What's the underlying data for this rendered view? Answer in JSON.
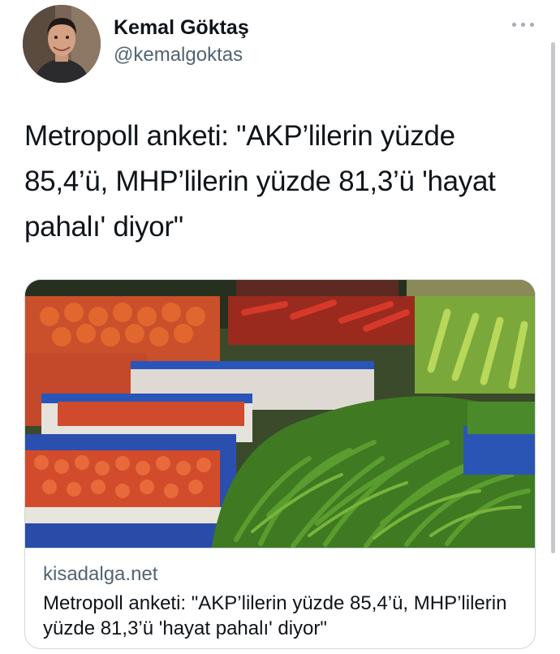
{
  "author": {
    "name": "Kemal Göktaş",
    "handle": "@kemalgoktas",
    "avatar_icon": "profile-photo"
  },
  "tweet": {
    "text": "Metropoll anketi: \"AKP’lilerin yüzde 85,4’ü, MHP’lilerin yüzde 81,3’ü 'hayat pahalı' diyor\""
  },
  "menu": {
    "icon": "more-horizontal-icon"
  },
  "card": {
    "image_icon": "market-vegetables-photo",
    "domain": "kisadalga.net",
    "title": "Metropoll anketi: \"AKP’lilerin yüzde 85,4’ü, MHP’lilerin yüzde 81,3’ü 'hayat pahalı' diyor\""
  },
  "colors": {
    "primary_text": "#0f1419",
    "secondary_text": "#536471",
    "border": "#cfd9de",
    "background": "#ffffff"
  }
}
